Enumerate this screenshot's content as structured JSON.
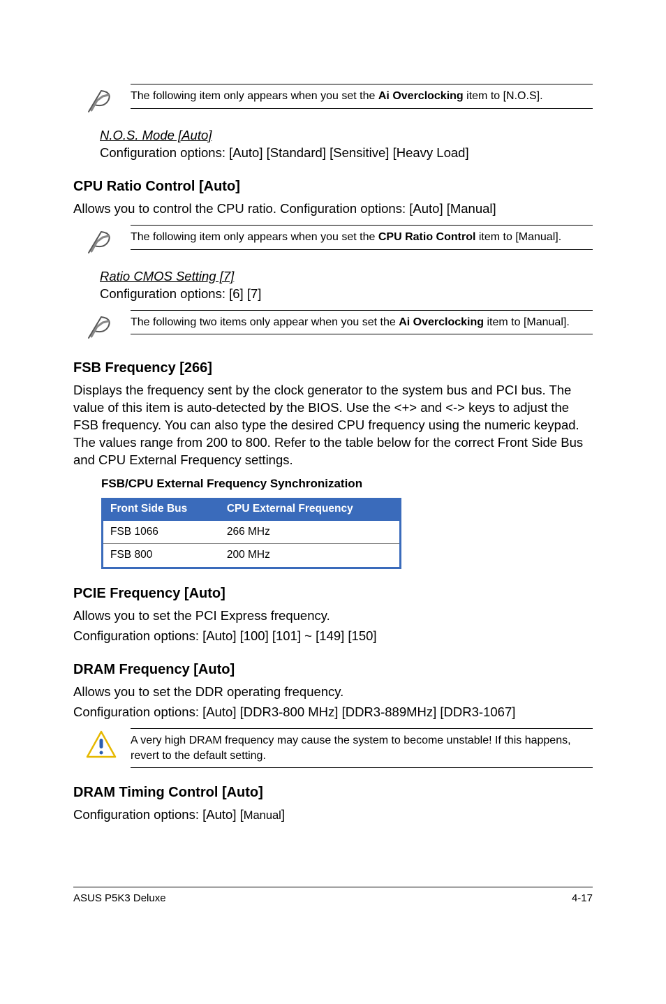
{
  "note1": {
    "text_pre": "The following item only appears when you set the ",
    "bold": "Ai Overclocking",
    "text_post": " item to [N.O.S]."
  },
  "nos_mode": {
    "title": "N.O.S. Mode [Auto]",
    "config": "Configuration options: [Auto] [Standard] [Sensitive] [Heavy Load]"
  },
  "cpu_ratio": {
    "heading": "CPU Ratio Control [Auto]",
    "body": "Allows you to control the CPU ratio. Configuration options: [Auto] [Manual]"
  },
  "note2": {
    "text_pre": "The following item only appears when you set the ",
    "bold": "CPU Ratio Control",
    "text_post": " item to [Manual]."
  },
  "ratio_cmos": {
    "title": "Ratio CMOS Setting [7]",
    "config": "Configuration options: [6] [7]"
  },
  "note3": {
    "text_pre": "The following two items only appear when you set the ",
    "bold": "Ai Overclocking",
    "text_post": " item to [Manual]."
  },
  "fsb": {
    "heading": "FSB Frequency [266]",
    "body": "Displays the frequency sent by the clock generator to the system bus and PCI bus. The value of this item is auto-detected by the BIOS. Use the <+> and <-> keys to adjust the FSB frequency. You can also type the desired CPU frequency using the numeric keypad. The values range from 200 to 800. Refer to the table below for the correct Front Side Bus and CPU External Frequency settings.",
    "table_title": "FSB/CPU External Frequency Synchronization",
    "table_headers": [
      "Front Side Bus",
      "CPU External Frequency"
    ],
    "table_rows": [
      [
        "FSB 1066",
        "266 MHz"
      ],
      [
        "FSB 800",
        "200 MHz"
      ]
    ]
  },
  "pcie": {
    "heading": "PCIE Frequency [Auto]",
    "body1": "Allows you to set the PCI Express frequency.",
    "body2": "Configuration options: [Auto] [100] [101] ~ [149] [150]"
  },
  "dram_freq": {
    "heading": "DRAM Frequency [Auto]",
    "body1": "Allows you to set the DDR operating frequency.",
    "body2": "Configuration options: [Auto] [DDR3-800 MHz] [DDR3-889MHz] [DDR3-1067]"
  },
  "warn": {
    "text": "A very high DRAM frequency may cause the system to become unstable! If this happens, revert to the default setting."
  },
  "dram_timing": {
    "heading": "DRAM Timing Control [Auto]",
    "body_pre": "Configuration options: [Auto] [",
    "body_small": "Manual",
    "body_post": "]"
  },
  "footer": {
    "left": "ASUS P5K3 Deluxe",
    "right": "4-17"
  }
}
